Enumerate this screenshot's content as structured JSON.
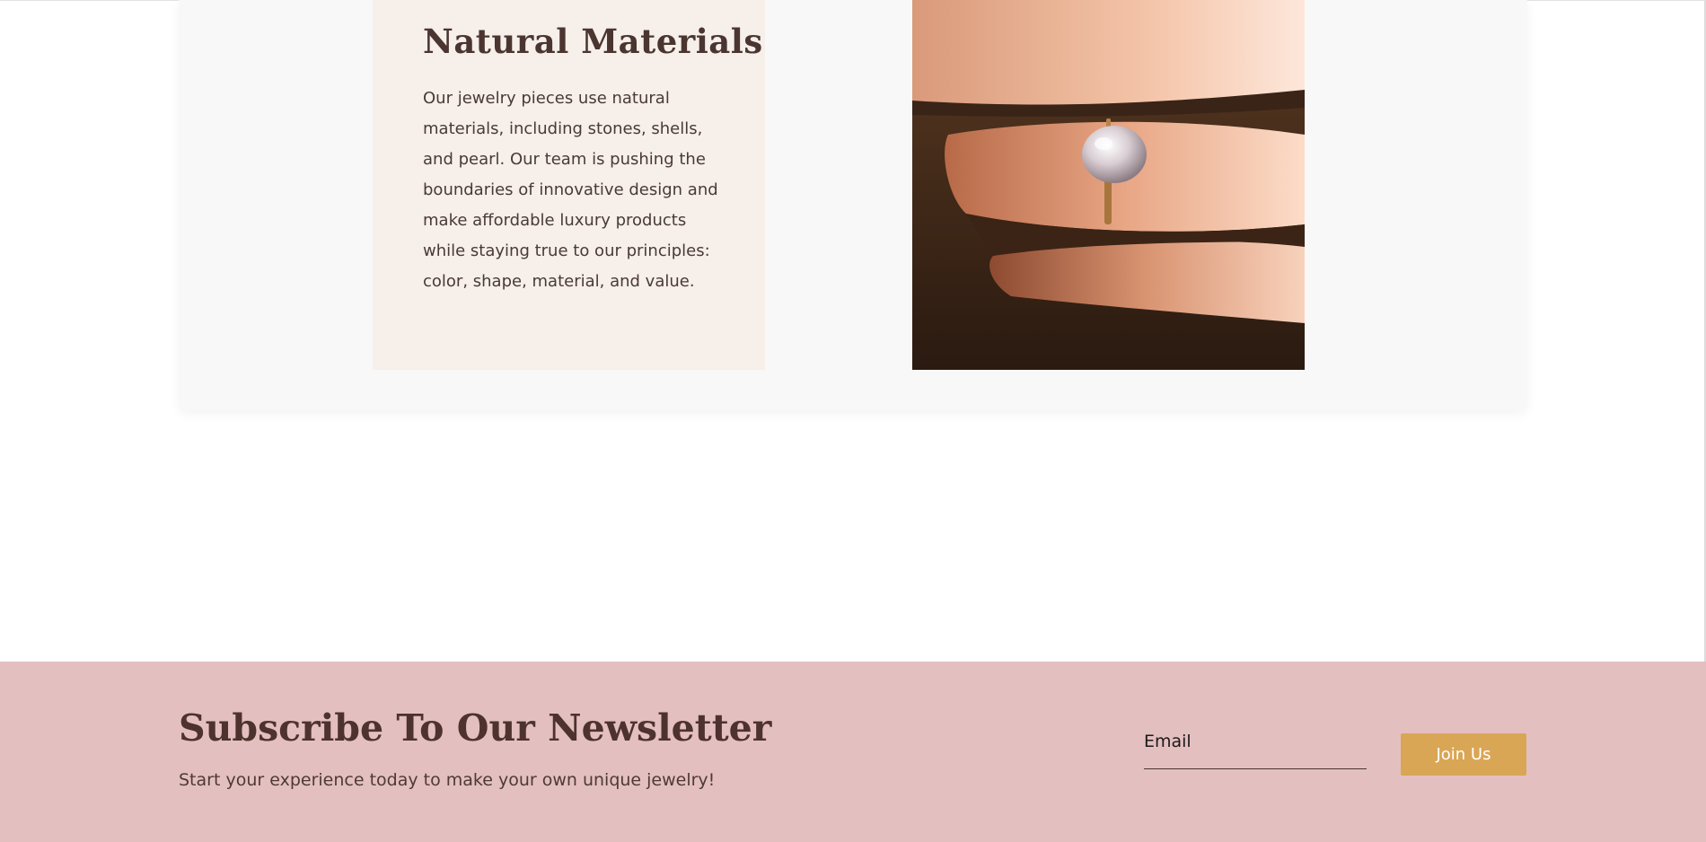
{
  "feature": {
    "title": "Natural Materials",
    "description": "Our jewelry pieces use natural materials, including stones, shells, and pearl. Our team is pushing the boundaries of innovative design and make affordable luxury products while staying true to our principles: color, shape, material, and value.",
    "image_subject": "hand-wearing-pearl-ring"
  },
  "newsletter": {
    "title": "Subscribe To Our Newsletter",
    "subtitle": "Start your experience today to make your own unique jewelry!",
    "email_placeholder": "Email",
    "email_value": "",
    "button_label": "Join Us"
  },
  "colors": {
    "panel_background": "#f6efea",
    "card_background": "#f8f8f8",
    "newsletter_background": "#e4bfc0",
    "button_background": "#d9a655",
    "heading_text": "#4a3530"
  }
}
